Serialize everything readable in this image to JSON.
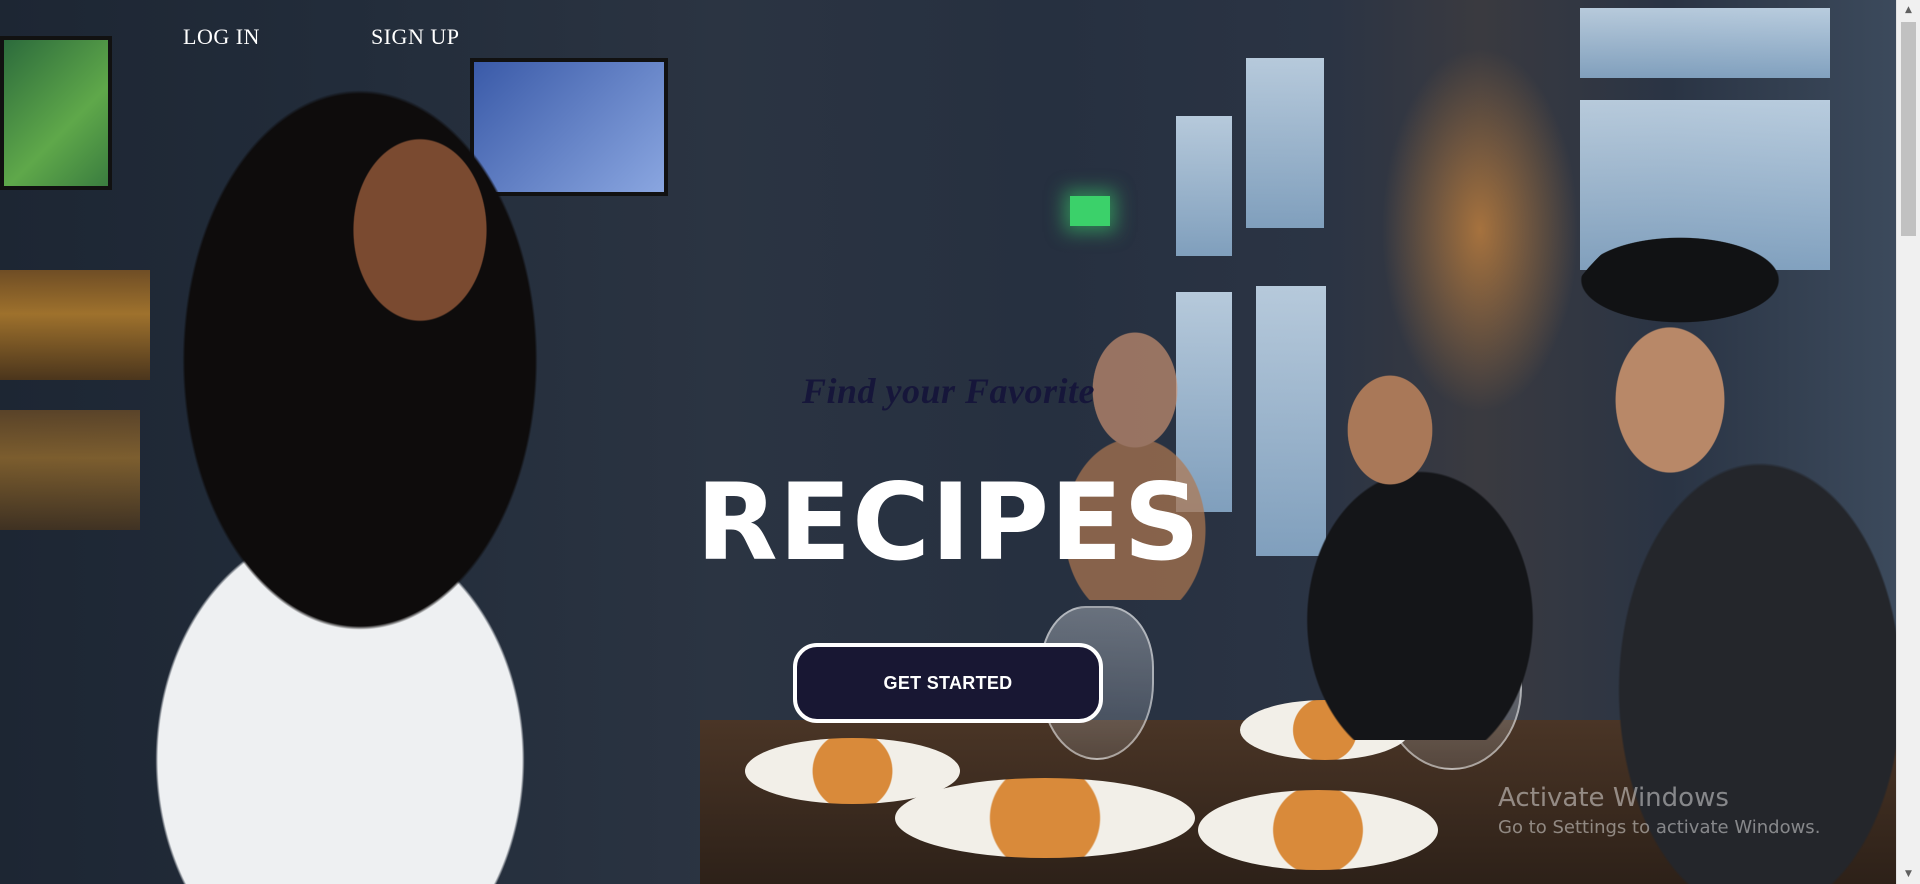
{
  "nav": {
    "login_label": "LOG IN",
    "signup_label": "SIGN UP"
  },
  "hero": {
    "tagline": "Find your Favorite",
    "headline": "RECIPES",
    "cta_label": "GET STARTED",
    "background_image": "people-eating-at-restaurant-photo"
  },
  "watermark": {
    "title": "Activate Windows",
    "subtitle": "Go to Settings to activate Windows."
  },
  "scrollbar": {
    "up_icon": "scroll-up-arrow-icon",
    "down_icon": "scroll-down-arrow-icon"
  },
  "colors": {
    "tagline": "#16163a",
    "cta_background": "#181733",
    "cta_border": "#ffffff",
    "headline": "#ffffff"
  }
}
